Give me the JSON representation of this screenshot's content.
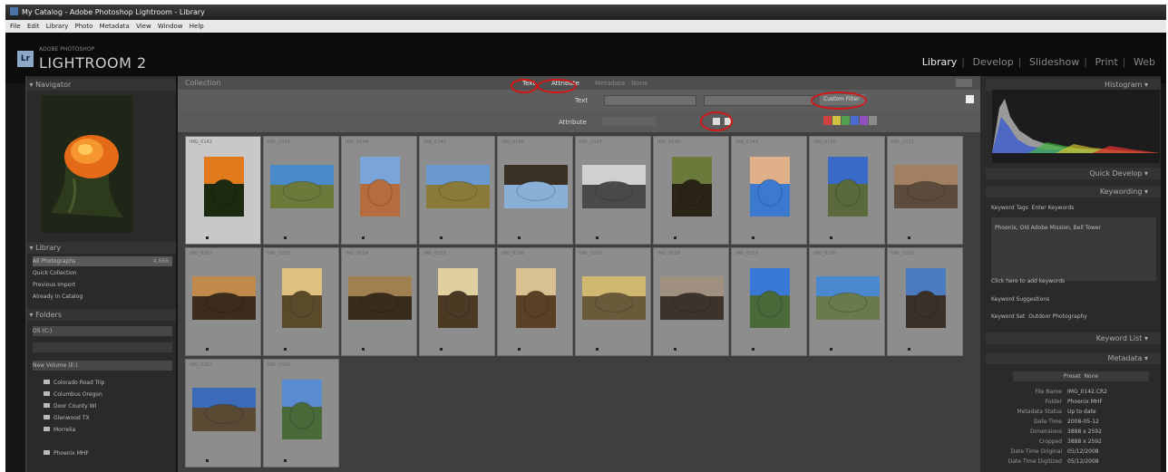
{
  "window": {
    "title": "My Catalog - Adobe Photoshop Lightroom - Library"
  },
  "menu": [
    "File",
    "Edit",
    "Library",
    "Photo",
    "Metadata",
    "View",
    "Window",
    "Help"
  ],
  "header": {
    "logo_letter": "Lr",
    "logo_sub": "ADOBE PHOTOSHOP",
    "app_name": "LIGHTROOM 2"
  },
  "modules": [
    "Library",
    "Develop",
    "Slideshow",
    "Print",
    "Web"
  ],
  "active_module": "Library",
  "left": {
    "navigator_title": "Navigator",
    "library_title": "Library",
    "library_items": [
      {
        "label": "All Photographs",
        "count": "4,868"
      },
      {
        "label": "Quick Collection",
        "count": ""
      },
      {
        "label": "Previous Import",
        "count": ""
      },
      {
        "label": "Already in Catalog",
        "count": ""
      }
    ],
    "folders_title": "Folders",
    "volumes": [
      "OS (C:)",
      "New Volume (E:)"
    ],
    "folders": [
      {
        "label": "Colorado Road Trip",
        "count": ""
      },
      {
        "label": "Columbus Oregon",
        "count": ""
      },
      {
        "label": "Door County WI",
        "count": ""
      },
      {
        "label": "Glenwood TX",
        "count": ""
      },
      {
        "label": "Morrelia",
        "count": ""
      },
      {
        "label": "Phoenix MHF",
        "count": ""
      }
    ]
  },
  "filterbar": {
    "title": "Collection",
    "tabs": [
      "Text",
      "Attribute",
      "Metadata",
      "None"
    ],
    "custom_filter": "Custom Filter",
    "attribute_label": "Attribute"
  },
  "right": {
    "histogram_title": "Histogram",
    "quick_develop": "Quick Develop",
    "keywording": "Keywording",
    "keyword_tags_label": "Keyword Tags",
    "keyword_tags_value": "Enter Keywords",
    "keyword_text": "Phoenix, Old Adobe Mission, Bell Tower",
    "click_add": "Click here to add keywords",
    "keyword_suggestions": "Keyword Suggestions",
    "keyword_set_label": "Keyword Set",
    "keyword_set_value": "Outdoor Photography",
    "keyword_list": "Keyword List",
    "metadata_title": "Metadata",
    "preset_label": "Preset",
    "preset_value": "None",
    "meta_rows": [
      {
        "label": "File Name",
        "value": "IMG_0142.CR2"
      },
      {
        "label": "Folder",
        "value": "Phoenix MHF"
      },
      {
        "label": "Metadata Status",
        "value": "Up to date"
      },
      {
        "label": "Date Time",
        "value": "2008-05-12"
      },
      {
        "label": "Dimensions",
        "value": "3888 x 2592"
      },
      {
        "label": "Cropped",
        "value": "3888 x 2592"
      },
      {
        "label": "Date Time Original",
        "value": "05/12/2008"
      },
      {
        "label": "Date Time Digitized",
        "value": "05/12/2008"
      }
    ]
  },
  "thumbs": [
    {
      "meta": "IMG_0142",
      "fg": "#e07a1c",
      "bg": "#1c2a12",
      "orient": "portrait"
    },
    {
      "meta": "IMG_0143",
      "fg": "#4a8ac8",
      "bg": "#6b7a3a",
      "orient": "landscape"
    },
    {
      "meta": "IMG_0144",
      "fg": "#7aa5d8",
      "bg": "#b56c3e",
      "orient": "portrait"
    },
    {
      "meta": "IMG_0145",
      "fg": "#6a98d0",
      "bg": "#8a7a3a",
      "orient": "landscape"
    },
    {
      "meta": "IMG_0146",
      "fg": "#3a3024",
      "bg": "#8ab0d8",
      "orient": "landscape"
    },
    {
      "meta": "IMG_0147",
      "fg": "#d0d0d0",
      "bg": "#4a4a4a",
      "orient": "landscape"
    },
    {
      "meta": "IMG_0148",
      "fg": "#6a7a3a",
      "bg": "#2a2416",
      "orient": "portrait"
    },
    {
      "meta": "IMG_0149",
      "fg": "#e0b088",
      "bg": "#3c7ad0",
      "orient": "portrait"
    },
    {
      "meta": "IMG_0150",
      "fg": "#3a6ac8",
      "bg": "#5a6a3a",
      "orient": "portrait"
    },
    {
      "meta": "IMG_0151",
      "fg": "#a08060",
      "bg": "#5c4a3c",
      "orient": "landscape"
    },
    {
      "meta": "IMG_0152",
      "fg": "#c08a4a",
      "bg": "#3c2c1c",
      "orient": "landscape"
    },
    {
      "meta": "IMG_0153",
      "fg": "#e0c080",
      "bg": "#5a4a2a",
      "orient": "portrait"
    },
    {
      "meta": "IMG_0154",
      "fg": "#a08050",
      "bg": "#3a2c1c",
      "orient": "landscape"
    },
    {
      "meta": "IMG_0155",
      "fg": "#e0d0a0",
      "bg": "#4a3a24",
      "orient": "portrait"
    },
    {
      "meta": "IMG_0156",
      "fg": "#d8c090",
      "bg": "#5a4024",
      "orient": "portrait"
    },
    {
      "meta": "IMG_0157",
      "fg": "#d0b870",
      "bg": "#6a5a3a",
      "orient": "landscape"
    },
    {
      "meta": "IMG_0158",
      "fg": "#a09080",
      "bg": "#3c342a",
      "orient": "landscape"
    },
    {
      "meta": "IMG_0159",
      "fg": "#3a78d8",
      "bg": "#4a6a3a",
      "orient": "portrait"
    },
    {
      "meta": "IMG_0160",
      "fg": "#4a88d0",
      "bg": "#6a7a4a",
      "orient": "landscape"
    },
    {
      "meta": "IMG_0161",
      "fg": "#4a7ac0",
      "bg": "#3a3028",
      "orient": "portrait"
    },
    {
      "meta": "IMG_0162",
      "fg": "#3a6ab8",
      "bg": "#5a4a34",
      "orient": "landscape"
    },
    {
      "meta": "IMG_0163",
      "fg": "#5a8ad0",
      "bg": "#4a6a3a",
      "orient": "portrait"
    }
  ]
}
